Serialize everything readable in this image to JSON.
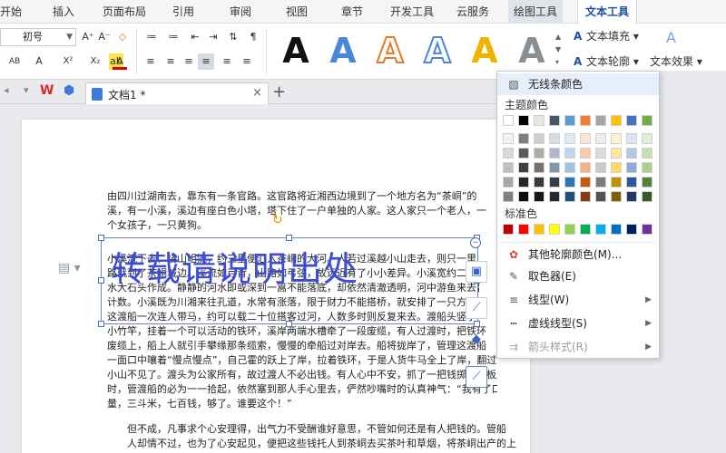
{
  "menu": {
    "tabs": [
      "开始",
      "插入",
      "页面布局",
      "引用",
      "审阅",
      "视图",
      "章节",
      "开发工具",
      "云服务",
      "绘图工具",
      "文本工具"
    ]
  },
  "ribbon": {
    "font_size": "初号",
    "buttons": {
      "grow": "A⁺",
      "shrink": "A⁻",
      "clear": "◇",
      "ab": "AB",
      "phonetic": "A",
      "super": "X²",
      "sub": "X₂",
      "highlight": "ab",
      "fontcolor": "A",
      "list1": "≔",
      "list2": "≔",
      "indent1": "⇤",
      "indent2": "⇥",
      "sort": "⇅",
      "show": "¶",
      "al1": "≡",
      "al2": "≡",
      "al3": "≡",
      "al4": "≡",
      "al5": "≡",
      "al6": "≡"
    },
    "text_fill": "文本填充",
    "text_outline": "文本轮廓",
    "text_effect": "文本效果",
    "gallery_letter": "A",
    "colors": {
      "accent": "#1d4fa3",
      "blue": "#4a86d9",
      "orange": "#e67a28",
      "gold": "#f0b400",
      "gray": "#8a8f96"
    }
  },
  "tabstrip": {
    "doc_name": "文档1 *",
    "close": "×",
    "plus": "+"
  },
  "document": {
    "lines_top": [
      "由四川过湖南去，靠东有一条官路。这官路将近湘西边境到了一个地方名为“茶峒”的",
      "溪，有一小溪，溪边有座白色小塔，塔下住了一户单独的人家。这人家只一个老人，一",
      "个女孩子，一只黄狗。"
    ],
    "lines_box": [
      "小溪流下去，绕山岨流，约三里便汇入茶峒的大河。人若过溪越小山走去，则只一里",
      "路就到了茶峒城边。溪流如弓背，山路如弓弦，故远近有了小小差异。小溪宽约二十丈",
      "水大石头作成。静静的河水即或深到一篙不能落底，却依然清澈透明，河中游鱼来去皆可",
      "计数。小溪既为川湘来往孔道，水常有涨落，限于财力不能搭桥，就安排了一只方头渡",
      "这渡船一次连人带马，约可以载二十位搭客过河，人数多时则反复来去。渡船头竖了一"
    ],
    "lines_bottom": [
      "小竹竿，挂着一个可以活动的铁环，溪岸两端水槽牵了一段废缆，有人过渡时，把铁环",
      "废缆上，船上人就引手攀缘那条缆索，慢慢的牵船过对岸去。船将拢岸了，管理这渡船",
      "一面口中嚷着“慢点慢点”，自己霍的跃上了岸，拉着铁环，于是人货牛马全上了岸，翻过",
      "小山不见了。渡头为公家所有，故过渡人不必出钱。有人心中不安，抓了一把钱掷到船板上",
      "时，管渡船的必为一一拾起，依然塞到那人手心里去，俨然吵嘴时的认真神气：“我有了口",
      "量，三斗米，七百钱，够了。谁要这个！”"
    ],
    "lines_last": [
      "但不成，凡事求个心安理得，出气力不受酬谁好意思，不管如何还是有人把钱的。管船",
      "人却情不过，也为了心安起见，便把这些钱托人到茶峒去买茶叶和草烟，将茶峒出产的上"
    ],
    "watermark": "转载请说明出处"
  },
  "dropdown": {
    "no_outline": "无线条颜色",
    "theme_label": "主题颜色",
    "standard_label": "标准色",
    "other_colors": "其他轮廓颜色(M)...",
    "eyedropper": "取色器(E)",
    "line_style": "线型(W)",
    "dash_style": "虚线线型(S)",
    "arrow_style": "箭头样式(R)",
    "theme_top": [
      "#ffffff",
      "#000000",
      "#e7e6e6",
      "#44546a",
      "#5b9bd5",
      "#ed7d31",
      "#a5a5a5",
      "#ffc000",
      "#4472c4",
      "#70ad47"
    ],
    "standard": [
      "#c00000",
      "#ff0000",
      "#ffc000",
      "#ffff00",
      "#92d050",
      "#00b050",
      "#00b0f0",
      "#0070c0",
      "#002060",
      "#7030a0"
    ]
  }
}
